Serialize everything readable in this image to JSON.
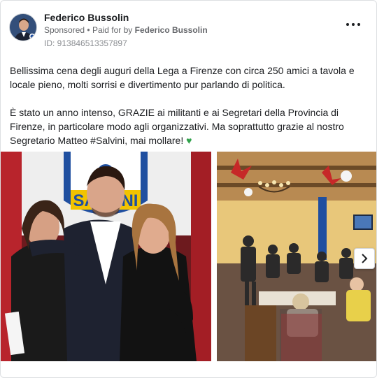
{
  "ad": {
    "page_name": "Federico Bussolin",
    "sponsored_label": "Sponsored",
    "paid_prefix": "Paid for by",
    "paid_by": "Federico Bussolin",
    "separator": "•",
    "ad_id": "ID: 913846513357897"
  },
  "post": {
    "paragraph1": "Bellissima cena degli auguri della Lega a Firenze con circa 250 amici a tavola e locale pieno, molti sorrisi e divertimento pur parlando di politica.",
    "paragraph2": "È stato un anno intenso, GRAZIE ai militanti e ai Segretari della Provincia di Firenze, in particolare modo agli organizzativi. Ma soprattutto grazie al nostro Segretario Matteo #Salvini, mai mollare!",
    "emoji": "♥"
  },
  "media": {
    "banner_text": "SALVINI",
    "icons": {
      "more": "more-options-icon",
      "next": "chevron-right-icon",
      "heart": "green-heart-icon"
    }
  },
  "colors": {
    "accent_green": "#31a24c",
    "text_primary": "#1c1e21",
    "text_secondary": "#65676b",
    "lega_blue": "#1f4fa0",
    "lega_yellow": "#f2c300"
  }
}
